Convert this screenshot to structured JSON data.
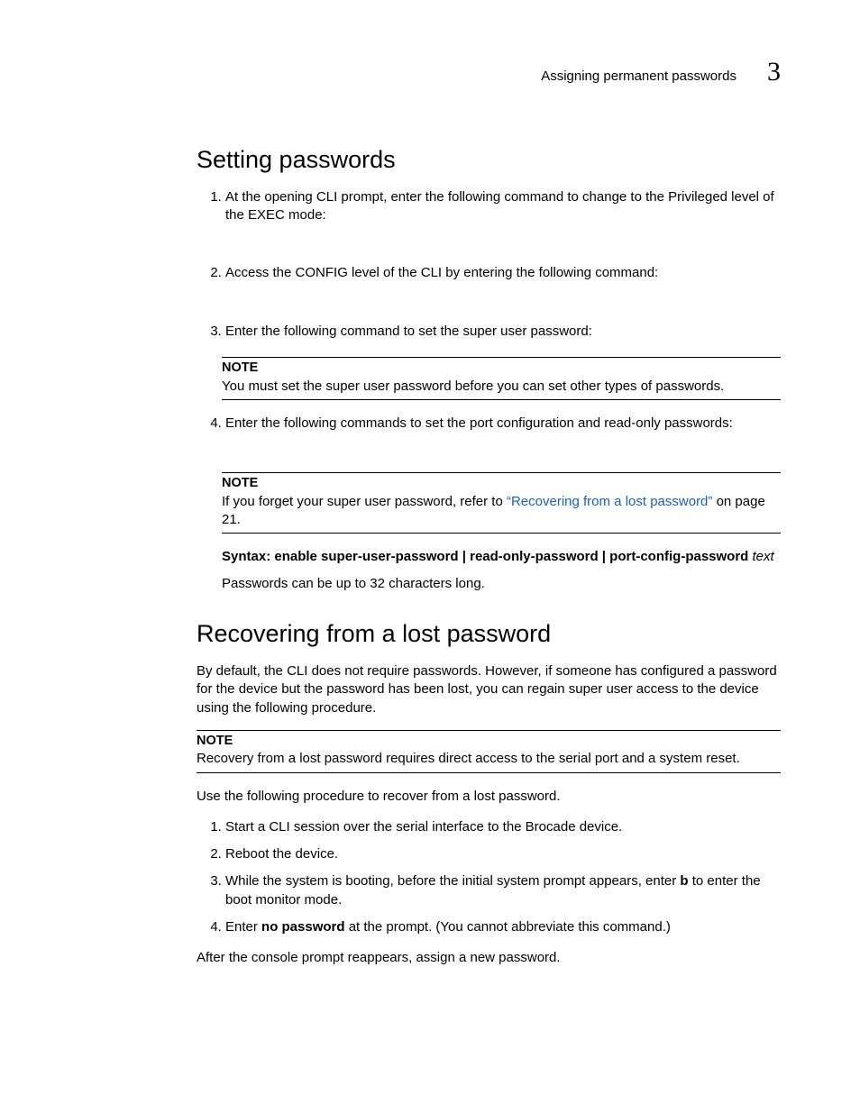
{
  "header": {
    "running_title": "Assigning permanent passwords",
    "chapter_number": "3"
  },
  "section1": {
    "title": "Setting passwords",
    "steps": [
      "At the opening CLI prompt, enter the following command to change to the Privileged level of the EXEC mode:",
      "Access the CONFIG level of the CLI by entering the following command:",
      "Enter the following command to set the super user password:",
      "Enter the following commands to set the port configuration and read-only passwords:"
    ],
    "note1": {
      "label": "NOTE",
      "body": "You must set the super user password before you can set other types of passwords."
    },
    "note2": {
      "label": "NOTE",
      "pre": "If you forget your super user password, refer to ",
      "link": "“Recovering from a lost password”",
      "post": " on page 21."
    },
    "syntax": {
      "label": "Syntax:",
      "text": "  enable super-user-password | read-only-password | port-config-password ",
      "arg": "text"
    },
    "tail": "Passwords can be up to 32 characters long."
  },
  "section2": {
    "title": "Recovering from a lost password",
    "intro": "By default, the CLI does not require passwords. However, if someone has configured a password for the device but the password has been lost, you can regain super user access to the device using the following procedure.",
    "note": {
      "label": "NOTE",
      "body": "Recovery from a lost password requires direct access to the serial port and a system reset."
    },
    "lead": "Use the following procedure to recover from a lost password.",
    "steps": {
      "s1": "Start a CLI session over the serial interface to the Brocade device.",
      "s2": "Reboot the device.",
      "s3_pre": "While the system is booting, before the initial system prompt appears, enter ",
      "s3_bold": "b",
      "s3_post": " to enter the boot monitor mode.",
      "s4_pre": "Enter ",
      "s4_bold": "no password",
      "s4_post": " at the prompt. (You cannot abbreviate this command.)"
    },
    "close": "After the console prompt reappears, assign a new password."
  }
}
